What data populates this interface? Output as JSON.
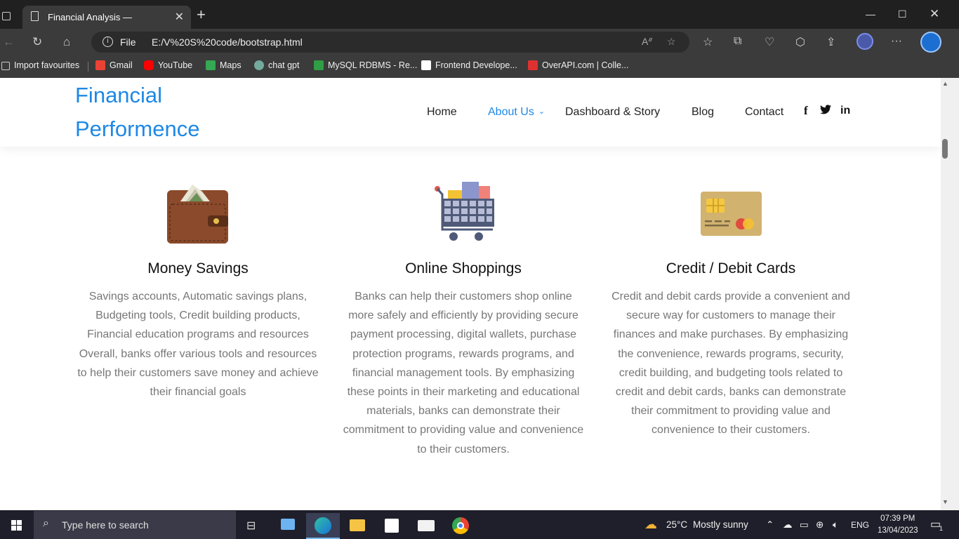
{
  "browser": {
    "tab_title": "Financial Analysis —",
    "scheme_label": "File",
    "url": "E:/V%20S%20code/bootstrap.html",
    "bookmarks": [
      {
        "label": "Import favourites",
        "color": "#cccccc"
      },
      {
        "label": "Gmail",
        "color": "#ea4335"
      },
      {
        "label": "YouTube",
        "color": "#ff0000"
      },
      {
        "label": "Maps",
        "color": "#34a853"
      },
      {
        "label": "chat gpt",
        "color": "#74aa9c"
      },
      {
        "label": "MySQL RDBMS - Re...",
        "color": "#2f9e44"
      },
      {
        "label": "Frontend Develope...",
        "color": "#ffffff"
      },
      {
        "label": "OverAPI.com | Colle...",
        "color": "#e03131"
      }
    ]
  },
  "site": {
    "brand_line1": "Financial",
    "brand_line2": "Performence",
    "nav": [
      "Home",
      "About Us",
      "Dashboard & Story",
      "Blog",
      "Contact"
    ],
    "active_nav": "About Us",
    "social": [
      "f",
      "twitter",
      "in"
    ],
    "accent": "#1e88e5"
  },
  "features": [
    {
      "icon": "wallet-icon",
      "title": "Money Savings",
      "text": "Savings accounts, Automatic savings plans, Budgeting tools, Credit building products, Financial education programs and resources Overall, banks offer various tools and resources to help their customers save money and achieve their financial goals"
    },
    {
      "icon": "shopping-cart-icon",
      "title": "Online Shoppings",
      "text": "Banks can help their customers shop online more safely and efficiently by providing secure payment processing, digital wallets, purchase protection programs, rewards programs, and financial management tools. By emphasizing these points in their marketing and educational materials, banks can demonstrate their commitment to providing value and convenience to their customers."
    },
    {
      "icon": "credit-card-icon",
      "title": "Credit / Debit Cards",
      "text": "Credit and debit cards provide a convenient and secure way for customers to manage their finances and make purchases. By emphasizing the convenience, rewards programs, security, credit building, and budgeting tools related to credit and debit cards, banks can demonstrate their commitment to providing value and convenience to their customers."
    }
  ],
  "taskbar": {
    "search_placeholder": "Type here to search",
    "weather_temp": "25°C",
    "weather_desc": "Mostly sunny",
    "language": "ENG",
    "time": "07:39 PM",
    "date": "13/04/2023",
    "notification_count": "1"
  }
}
